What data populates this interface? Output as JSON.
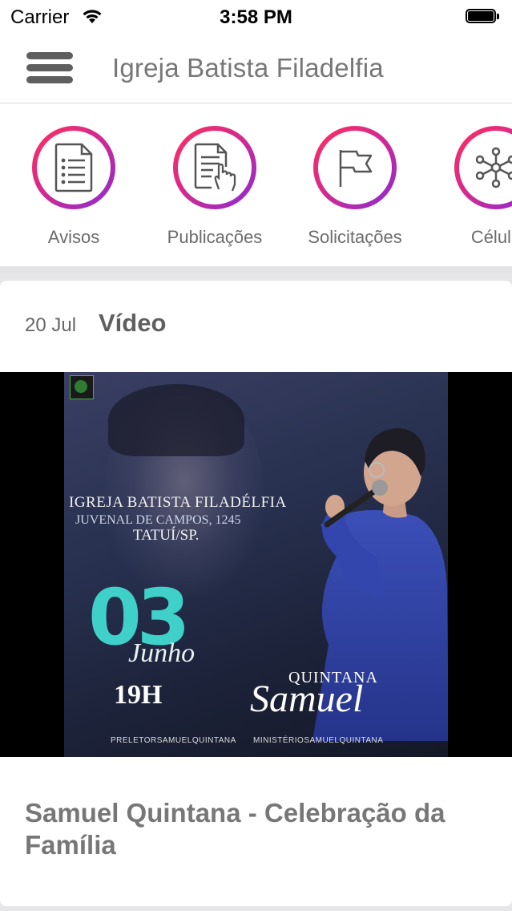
{
  "status_bar": {
    "carrier": "Carrier",
    "time": "3:58 PM"
  },
  "nav": {
    "title": "Igreja Batista Filadelfia"
  },
  "shortcuts": [
    {
      "label": "Avisos",
      "icon": "document-list-icon"
    },
    {
      "label": "Publicações",
      "icon": "document-touch-icon"
    },
    {
      "label": "Solicitações",
      "icon": "flag-icon"
    },
    {
      "label": "Célula",
      "icon": "network-icon"
    }
  ],
  "colors": {
    "ring_gradient": [
      "#ff2f5e",
      "#d62a8c",
      "#8a2bd6"
    ],
    "header_text": "#777777",
    "background": "#e6e6e8"
  },
  "card": {
    "date": "20 Jul",
    "type": "Vídeo",
    "title": "Samuel Quintana - Celebração da Família",
    "poster": {
      "church": "IGREJA BATISTA FILADÉLFIA",
      "address": "JUVENAL DE CAMPOS, 1245",
      "city": "TATUÍ/SP.",
      "day": "03",
      "month": "Junho",
      "time": "19H",
      "signature_top": "QUINTANA",
      "signature_main": "Samuel",
      "social_facebook": "PRELETORSAMUELQUINTANA",
      "social_youtube": "MINISTÉRIOSAMUELQUINTANA"
    }
  }
}
